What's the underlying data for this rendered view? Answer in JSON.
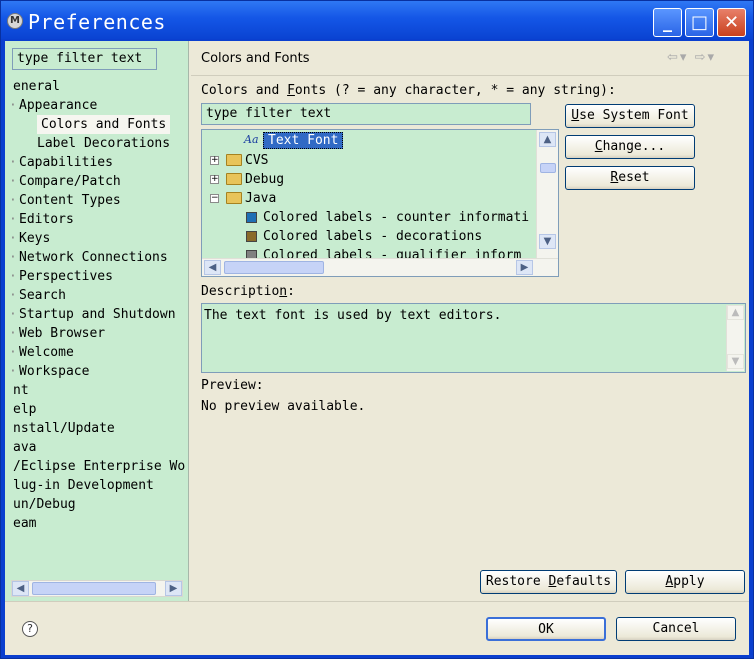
{
  "window": {
    "title": "Preferences",
    "app_icon_letter": "M",
    "minimize": "_",
    "maximize": "□",
    "close": "✕"
  },
  "nav": {
    "filter_value": "type filter text",
    "items": [
      {
        "label": "eneral",
        "level": 0
      },
      {
        "label": "Appearance",
        "level": 1
      },
      {
        "label": "Colors and Fonts",
        "level": 2,
        "selected": true
      },
      {
        "label": "Label Decorations",
        "level": 2
      },
      {
        "label": "Capabilities",
        "level": 1
      },
      {
        "label": "Compare/Patch",
        "level": 1
      },
      {
        "label": "Content Types",
        "level": 1
      },
      {
        "label": "Editors",
        "level": 1
      },
      {
        "label": "Keys",
        "level": 1
      },
      {
        "label": "Network Connections",
        "level": 1
      },
      {
        "label": "Perspectives",
        "level": 1
      },
      {
        "label": "Search",
        "level": 1
      },
      {
        "label": "Startup and Shutdown",
        "level": 1
      },
      {
        "label": "Web Browser",
        "level": 1
      },
      {
        "label": "Welcome",
        "level": 1
      },
      {
        "label": "Workspace",
        "level": 1
      },
      {
        "label": "nt",
        "level": 0
      },
      {
        "label": "elp",
        "level": 0
      },
      {
        "label": "nstall/Update",
        "level": 0
      },
      {
        "label": "ava",
        "level": 0
      },
      {
        "label": "/Eclipse Enterprise Wo",
        "level": 0
      },
      {
        "label": "lug-in Development",
        "level": 0
      },
      {
        "label": "un/Debug",
        "level": 0
      },
      {
        "label": "eam",
        "level": 0
      }
    ]
  },
  "content": {
    "page_title": "Colors and Fonts",
    "nav_back": "⇦",
    "nav_forward": "⇨",
    "dropdown_glyph": "▾",
    "filter_label_pre": "Colors and ",
    "filter_label_mnemonic": "F",
    "filter_label_post": "onts (? = any character, * = any string):",
    "filter_value": "type filter text",
    "tree": [
      {
        "label": "Text Font",
        "kind": "font",
        "icon_text": "Aa",
        "selected": true
      },
      {
        "label": "CVS",
        "kind": "folder",
        "expander": "+"
      },
      {
        "label": "Debug",
        "kind": "folder",
        "expander": "+"
      },
      {
        "label": "Java",
        "kind": "folder",
        "expander": "−"
      },
      {
        "label": "Colored labels - counter informati",
        "kind": "color",
        "color": "#1f6fb5"
      },
      {
        "label": "Colored labels - decorations",
        "kind": "color",
        "color": "#8a6a2a"
      },
      {
        "label": "Colored labels - qualifier inform",
        "kind": "color",
        "color": "#808080"
      }
    ],
    "buttons": {
      "use_system_font": {
        "mnemonic": "U",
        "rest": "se System Font"
      },
      "change": {
        "mnemonic": "C",
        "rest": "hange..."
      },
      "reset": {
        "mnemonic": "R",
        "rest": "eset"
      }
    },
    "description_label_pre": "Descriptio",
    "description_label_mnemonic": "n",
    "description_label_post": ":",
    "description_text": "The text font is used by text editors.",
    "preview_label": "Preview:",
    "preview_text": "No preview available.",
    "restore_defaults": {
      "pre": "Restore ",
      "mnemonic": "D",
      "post": "efaults"
    },
    "apply": {
      "mnemonic": "A",
      "rest": "pply"
    }
  },
  "footer": {
    "help": "?",
    "ok": "OK",
    "cancel": "Cancel"
  },
  "colors": {
    "pane_bg": "#c8ecd0",
    "dialog_bg": "#ece9d8",
    "title_blue": "#0a43d2",
    "selection": "#316ac5"
  }
}
